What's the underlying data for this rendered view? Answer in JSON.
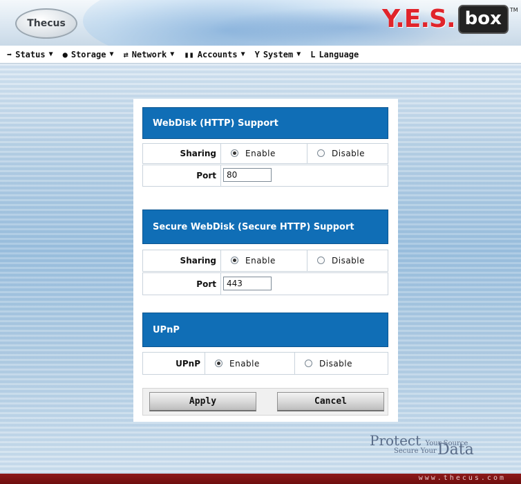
{
  "header": {
    "logo_left": "Thecus",
    "logo_yes": "Y.E.S.",
    "logo_box": "box",
    "logo_tm": "TM"
  },
  "nav": {
    "items": [
      {
        "label": "Status",
        "icon": "status-icon"
      },
      {
        "label": "Storage",
        "icon": "storage-icon"
      },
      {
        "label": "Network",
        "icon": "network-icon"
      },
      {
        "label": "Accounts",
        "icon": "accounts-icon"
      },
      {
        "label": "System",
        "icon": "system-icon"
      },
      {
        "label": "Language",
        "icon": "language-icon"
      }
    ],
    "dropdown_glyph": "▼"
  },
  "webdisk": {
    "title": "WebDisk (HTTP) Support",
    "sharing_label": "Sharing",
    "enable_label": "Enable",
    "disable_label": "Disable",
    "sharing_value": "Enable",
    "port_label": "Port",
    "port_value": "80"
  },
  "secure_webdisk": {
    "title": "Secure WebDisk (Secure HTTP) Support",
    "sharing_label": "Sharing",
    "enable_label": "Enable",
    "disable_label": "Disable",
    "sharing_value": "Enable",
    "port_label": "Port",
    "port_value": "443"
  },
  "upnp": {
    "title": "UPnP",
    "label": "UPnP",
    "enable_label": "Enable",
    "disable_label": "Disable",
    "value": "Enable"
  },
  "buttons": {
    "apply": "Apply",
    "cancel": "Cancel"
  },
  "branding": {
    "tag_protect": "Protect",
    "tag_your_source": "Your Source",
    "tag_secure_your": "Secure Your",
    "tag_data": "Data",
    "footer_url": "www.thecus.com"
  },
  "colors": {
    "section_header": "#106eb6",
    "footer": "#7a1414",
    "logo_red": "#e0242b"
  }
}
